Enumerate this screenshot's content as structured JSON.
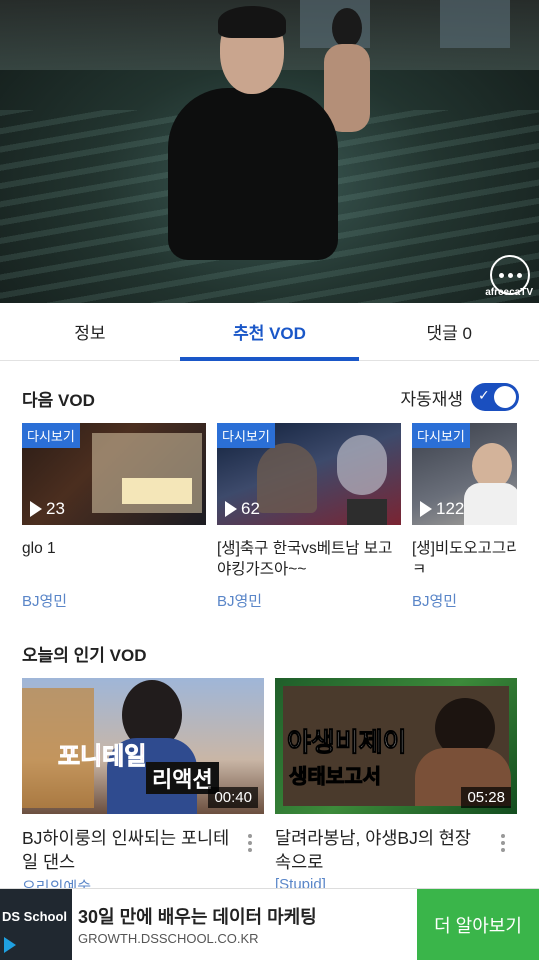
{
  "video": {
    "brand": "afreecaTV"
  },
  "tabs": [
    {
      "label": "정보"
    },
    {
      "label": "추천 VOD"
    },
    {
      "label": "댓글 0"
    }
  ],
  "next_vod": {
    "title": "다음 VOD",
    "autoplay_label": "자동재생",
    "autoplay_on": true,
    "items": [
      {
        "tag": "다시보기",
        "views": "23",
        "title": "glo 1",
        "author": "BJ영민"
      },
      {
        "tag": "다시보기",
        "views": "62",
        "title": "[생]축구 한국vs베트남 보고 야킹가즈아~~",
        "author": "BJ영민"
      },
      {
        "tag": "다시보기",
        "views": "122",
        "title": "[생]비도오고그리 ..철권...ㅋㅋ",
        "author": "BJ영민"
      }
    ]
  },
  "popular_vod": {
    "title": "오늘의 인기 VOD",
    "items": [
      {
        "duration": "00:40",
        "title": "BJ하이룽의 인싸되는 포니테일 댄스",
        "author": "오리의예술",
        "overlay_1": "포니테일",
        "overlay_2": "리액션"
      },
      {
        "duration": "05:28",
        "title": "달려라봉남, 야생BJ의 현장속으로",
        "author": "[Stupid]",
        "overlay_1": "야생비제이",
        "overlay_2": "생태보고서"
      }
    ]
  },
  "ad": {
    "logo": "DS School",
    "headline": "30일 만에 배우는 데이터 마케팅",
    "url": "GROWTH.DSSCHOOL.CO.KR",
    "cta": "더 알아보기"
  },
  "colors": {
    "accent": "#1a57c8",
    "link": "#5a86c8",
    "tag": "#2b6fd6",
    "cta": "#3ab54a"
  }
}
